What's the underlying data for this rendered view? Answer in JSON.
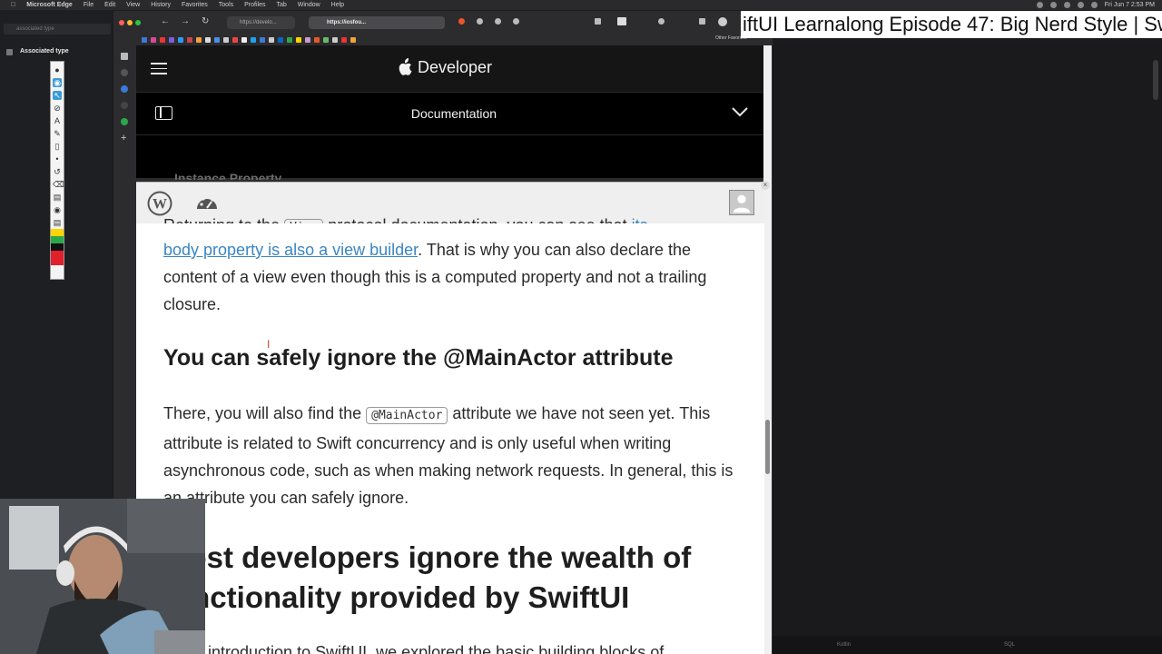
{
  "menubar": {
    "app": "Microsoft Edge",
    "items": [
      "File",
      "Edit",
      "View",
      "History",
      "Favorites",
      "Tools",
      "Profiles",
      "Tab",
      "Window",
      "Help"
    ],
    "clock": "Fri Jun 7  2:53 PM"
  },
  "left_panel": {
    "search_placeholder": "associated type",
    "selected_item": "Associated type"
  },
  "video_title": "iftUI Learnalong Episode 47: Big Nerd Style  | Sw",
  "browser": {
    "url_tab_1": "https://develo...",
    "url_tab_2": "https://iosfou...",
    "other_favorites": "Other Favorites"
  },
  "apple_developer": {
    "brand": "Developer",
    "doc_title": "Documentation",
    "ghost_heading": "Instance Property"
  },
  "article": {
    "cut_line_start": "Returning to the ",
    "cut_line_code": "View",
    "cut_line_end": " protocol documentation, you can see that ",
    "cut_line_link": "its",
    "para1_link": "body property is also a view builder",
    "para1_rest": ". That is why you can also declare the content of a view even though this is a computed property and not a trailing closure.",
    "h3": "You can safely ignore the @MainActor attribute",
    "para2_start": "There, you will also find the ",
    "para2_code": "@MainActor",
    "para2_rest": " attribute we have not seen yet. This attribute is related to Swift concurrency and is only useful when writing asynchronous code, such as when making network requests. In general, this is an attribute you can safely ignore.",
    "h2": "Most developers ignore the wealth of functionality provided by SwiftUI",
    "bottom_cut": "In my introduction to SwiftUI, we explored the basic building blocks of"
  },
  "right_panel": {
    "bottom_left": "Kotlin",
    "bottom_right": "SQL"
  },
  "colors": {
    "apple_header": "#151515",
    "link": "#3a86c2",
    "wp_bar": "#efefef",
    "annotation_active": "#3b9ad8"
  }
}
